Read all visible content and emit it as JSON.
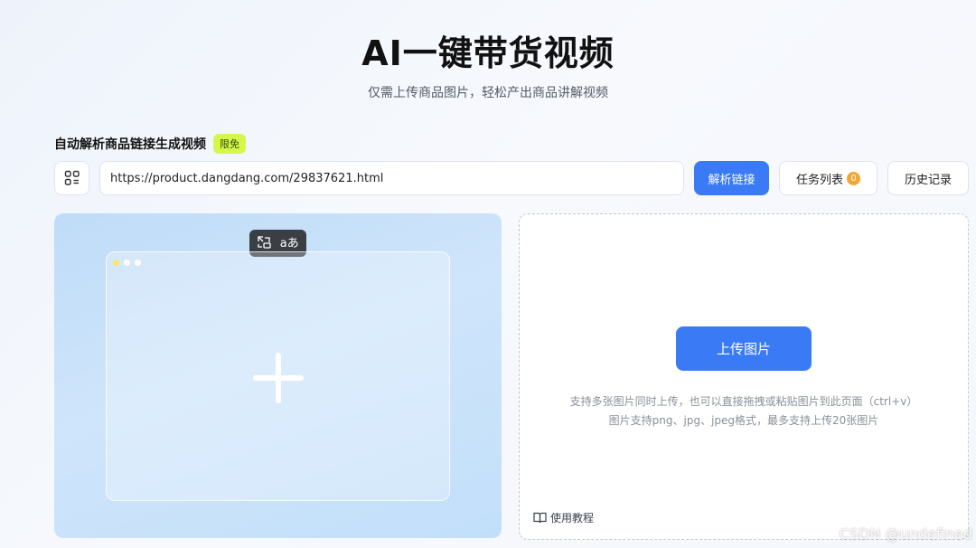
{
  "header": {
    "title": "AI一键带货视频",
    "subtitle": "仅需上传商品图片，轻松产出商品讲解视频"
  },
  "link_section": {
    "label": "自动解析商品链接生成视频",
    "badge": "限免",
    "icon": "apps-icon",
    "url_value": "https://product.dangdang.com/29837621.html",
    "parse_button": "解析链接",
    "tasks_button": "任务列表",
    "tasks_count": "0",
    "history_button": "历史记录"
  },
  "preview": {
    "toolbar_icons": [
      "swap-layout-icon",
      "translate-icon"
    ],
    "translate_glyph": "aあ",
    "add_icon": "plus-icon"
  },
  "upload": {
    "button": "上传图片",
    "hint_line1": "支持多张图片同时上传，也可以直接拖拽或粘贴图片到此页面（ctrl+v）",
    "hint_line2": "图片支持png、jpg、jpeg格式，最多支持上传20张图片",
    "tutorial": "使用教程"
  },
  "watermark": "CSDN @undefined",
  "colors": {
    "primary": "#3a7af4",
    "badge_bg": "#d4f74a",
    "count_badge": "#f0a830"
  }
}
